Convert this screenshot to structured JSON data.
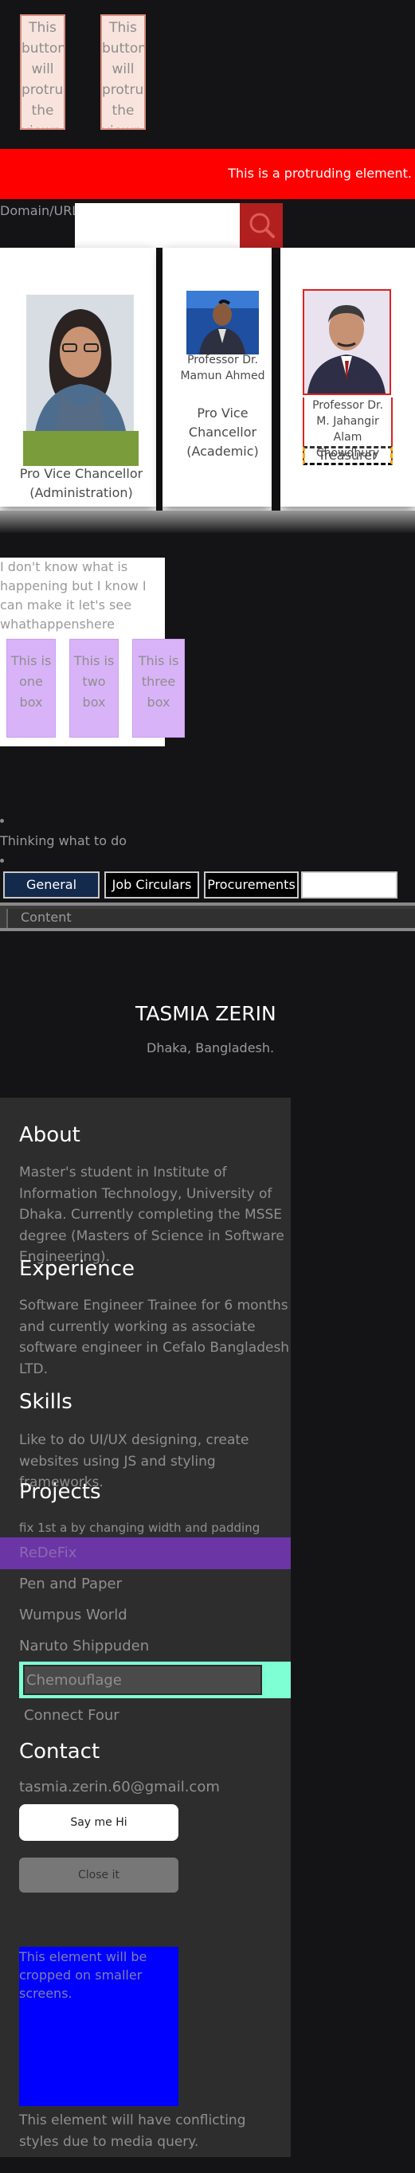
{
  "viewport_buttons": [
    {
      "label": "This button will protrude the viewport"
    },
    {
      "label": "This button will protrude the viewport"
    }
  ],
  "protruding": {
    "text": "This is a protruding element."
  },
  "domain": {
    "label": "Domain/URL:",
    "value": ""
  },
  "cards": [
    {
      "name": "",
      "title": "Pro Vice Chancellor (Administration)"
    },
    {
      "name": "Professor Dr. Mamun Ahmed",
      "title": "Pro Vice Chancellor (Academic)"
    },
    {
      "name": "Professor Dr. M. Jahangir Alam Chowdhury",
      "title": "Treasurer"
    }
  ],
  "whatif": {
    "text": "I don't know what is happening but I know I can make it let's see whathappenshere",
    "boxes": [
      "This is one box",
      "This is two box",
      "This is three box"
    ]
  },
  "thinking": "Thinking what to do",
  "tabs": [
    "General Notice",
    "Job Circulars",
    "Procurements"
  ],
  "content_label": "Content",
  "profile": {
    "name": "TASMIA ZERIN",
    "location": "Dhaka, Bangladesh."
  },
  "about": {
    "heading": "About",
    "text": "Master's student in Institute of Information Technology, University of Dhaka. Currently completing the MSSE degree (Masters of Science in Software Engineering)."
  },
  "experience": {
    "heading": "Experience",
    "text": "Software Engineer Trainee for 6 months and currently working as associate software engineer in Cefalo Bangladesh LTD."
  },
  "skills": {
    "heading": "Skills",
    "text": "Like to do UI/UX designing, create websites using JS and styling frameworks."
  },
  "projects": {
    "heading": "Projects",
    "note": "fix 1st a by changing width and padding",
    "items": [
      "ReDeFix",
      "Pen and Paper",
      "Wumpus World",
      "Naruto Shippuden",
      "Chemouflage",
      "Connect Four"
    ]
  },
  "contact": {
    "heading": "Contact",
    "email": "tasmia.zerin.60@gmail.com",
    "say_label": "Say me Hi",
    "close_label": "Close it"
  },
  "crop_note": "This element will be cropped on smaller screens.",
  "conflict_note": "This element will have conflicting styles due to media query.",
  "colors": {
    "red_bar": "#ff0000",
    "blue_box": "#0000ff",
    "projects_highlight": "#6b35a5",
    "mint": "#7fffd4"
  }
}
